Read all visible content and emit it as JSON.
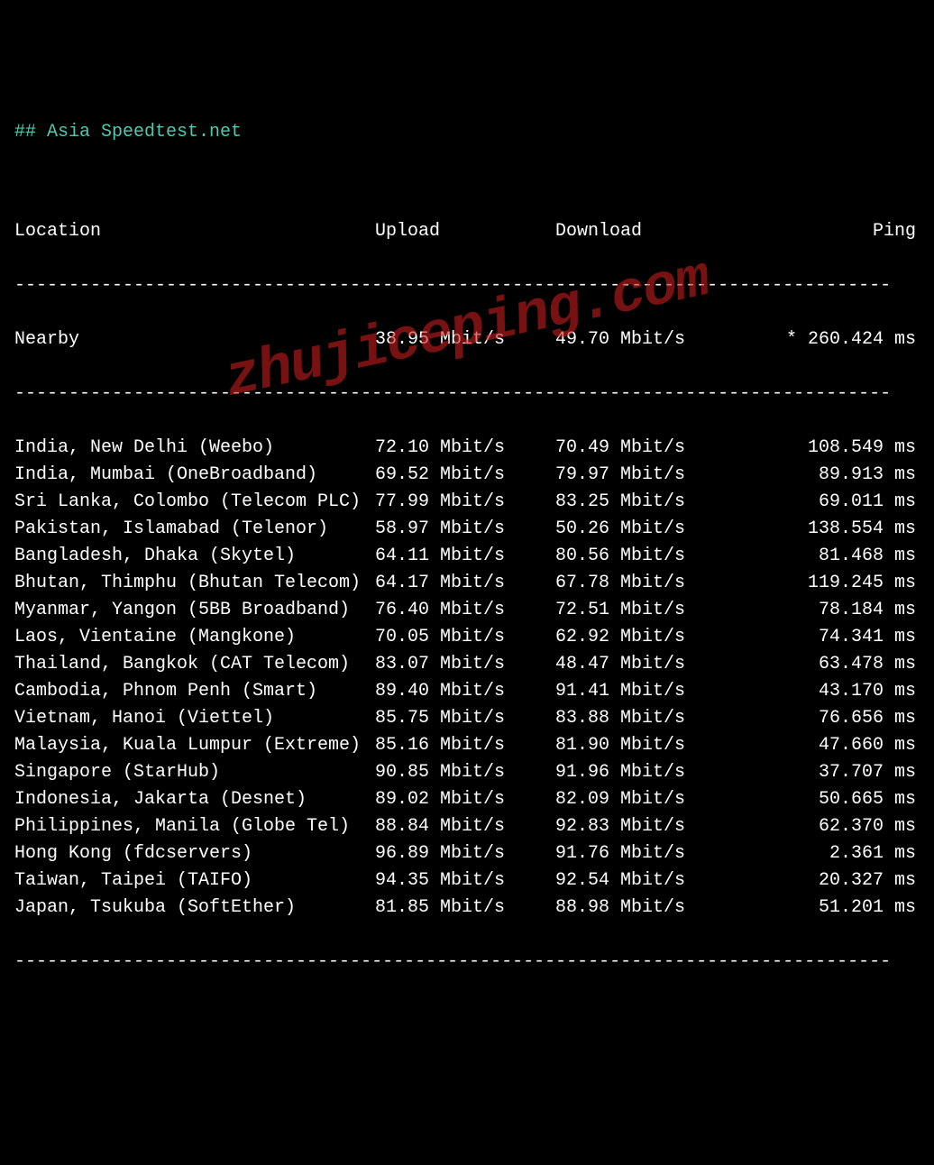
{
  "title": "## Asia Speedtest.net",
  "headers": {
    "location": "Location",
    "upload": "Upload",
    "download": "Download",
    "ping": "Ping"
  },
  "nearby": {
    "location": "Nearby",
    "upload": "38.95 Mbit/s",
    "download": "49.70 Mbit/s",
    "ping": "* 260.424 ms"
  },
  "rows": [
    {
      "location": "India, New Delhi (Weebo)",
      "upload": "72.10 Mbit/s",
      "download": "70.49 Mbit/s",
      "ping": "108.549 ms"
    },
    {
      "location": "India, Mumbai (OneBroadband)",
      "upload": "69.52 Mbit/s",
      "download": "79.97 Mbit/s",
      "ping": "89.913 ms"
    },
    {
      "location": "Sri Lanka, Colombo (Telecom PLC)",
      "upload": "77.99 Mbit/s",
      "download": "83.25 Mbit/s",
      "ping": "69.011 ms"
    },
    {
      "location": "Pakistan, Islamabad (Telenor)",
      "upload": "58.97 Mbit/s",
      "download": "50.26 Mbit/s",
      "ping": "138.554 ms"
    },
    {
      "location": "Bangladesh, Dhaka (Skytel)",
      "upload": "64.11 Mbit/s",
      "download": "80.56 Mbit/s",
      "ping": "81.468 ms"
    },
    {
      "location": "Bhutan, Thimphu (Bhutan Telecom)",
      "upload": "64.17 Mbit/s",
      "download": "67.78 Mbit/s",
      "ping": "119.245 ms"
    },
    {
      "location": "Myanmar, Yangon (5BB Broadband)",
      "upload": "76.40 Mbit/s",
      "download": "72.51 Mbit/s",
      "ping": "78.184 ms"
    },
    {
      "location": "Laos, Vientaine (Mangkone)",
      "upload": "70.05 Mbit/s",
      "download": "62.92 Mbit/s",
      "ping": "74.341 ms"
    },
    {
      "location": "Thailand, Bangkok (CAT Telecom)",
      "upload": "83.07 Mbit/s",
      "download": "48.47 Mbit/s",
      "ping": "63.478 ms"
    },
    {
      "location": "Cambodia, Phnom Penh (Smart)",
      "upload": "89.40 Mbit/s",
      "download": "91.41 Mbit/s",
      "ping": "43.170 ms"
    },
    {
      "location": "Vietnam, Hanoi (Viettel)",
      "upload": "85.75 Mbit/s",
      "download": "83.88 Mbit/s",
      "ping": "76.656 ms"
    },
    {
      "location": "Malaysia, Kuala Lumpur (Extreme)",
      "upload": "85.16 Mbit/s",
      "download": "81.90 Mbit/s",
      "ping": "47.660 ms"
    },
    {
      "location": "Singapore (StarHub)",
      "upload": "90.85 Mbit/s",
      "download": "91.96 Mbit/s",
      "ping": "37.707 ms"
    },
    {
      "location": "Indonesia, Jakarta (Desnet)",
      "upload": "89.02 Mbit/s",
      "download": "82.09 Mbit/s",
      "ping": "50.665 ms"
    },
    {
      "location": "Philippines, Manila (Globe Tel)",
      "upload": "88.84 Mbit/s",
      "download": "92.83 Mbit/s",
      "ping": "62.370 ms"
    },
    {
      "location": "Hong Kong (fdcservers)",
      "upload": "96.89 Mbit/s",
      "download": "91.76 Mbit/s",
      "ping": "2.361 ms"
    },
    {
      "location": "Taiwan, Taipei (TAIFO)",
      "upload": "94.35 Mbit/s",
      "download": "92.54 Mbit/s",
      "ping": "20.327 ms"
    },
    {
      "location": "Japan, Tsukuba (SoftEther)",
      "upload": "81.85 Mbit/s",
      "download": "88.98 Mbit/s",
      "ping": "51.201 ms"
    }
  ],
  "watermark": "zhujiceping.com",
  "divider": "---------------------------------------------------------------------------------"
}
